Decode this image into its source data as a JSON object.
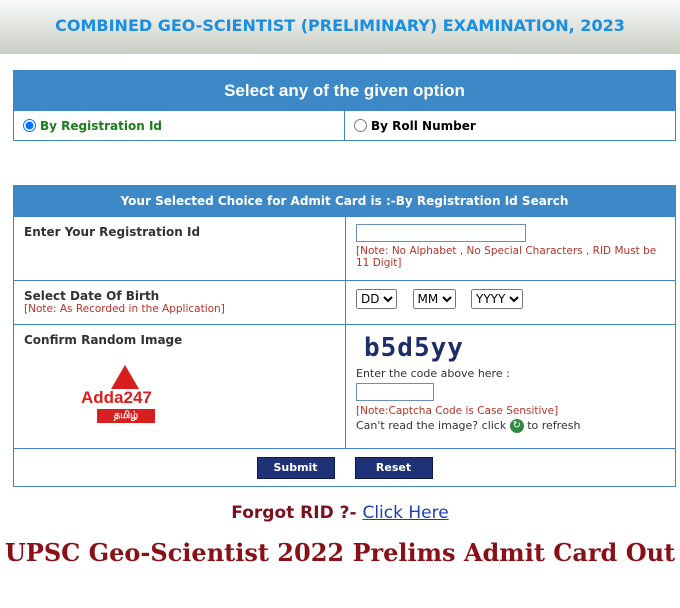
{
  "header": {
    "title": "COMBINED GEO-SCIENTIST (PRELIMINARY) EXAMINATION, 2023"
  },
  "options": {
    "title": "Select any of the given option",
    "registration_label": "By Registration Id",
    "roll_label": "By Roll Number"
  },
  "form": {
    "heading": "Your Selected Choice for Admit Card is :-By Registration Id Search",
    "reg_label": "Enter Your Registration Id",
    "reg_note": "[Note: No Alphabet , No Special Characters , RID Must be 11 Digit]",
    "dob_label": "Select Date Of Birth",
    "dob_note": "[Note: As Recorded in the Application]",
    "dob_day": "DD",
    "dob_month": "MM",
    "dob_year": "YYYY",
    "captcha_label": "Confirm Random Image",
    "captcha_code": "b5d5yy",
    "captcha_prompt": "Enter the code above here :",
    "captcha_note": "[Note:Captcha Code is Case Sensitive]",
    "refresh_text_before": "Can't read the image? click",
    "refresh_text_after": "to refresh",
    "submit_label": "Submit",
    "reset_label": "Reset"
  },
  "logo": {
    "brand": "Adda247",
    "sub": "தமிழ்"
  },
  "forgot": {
    "text": "Forgot RID ?-",
    "link": "Click Here"
  },
  "footer": {
    "headline": "UPSC Geo-Scientist 2022 Prelims Admit Card Out"
  }
}
